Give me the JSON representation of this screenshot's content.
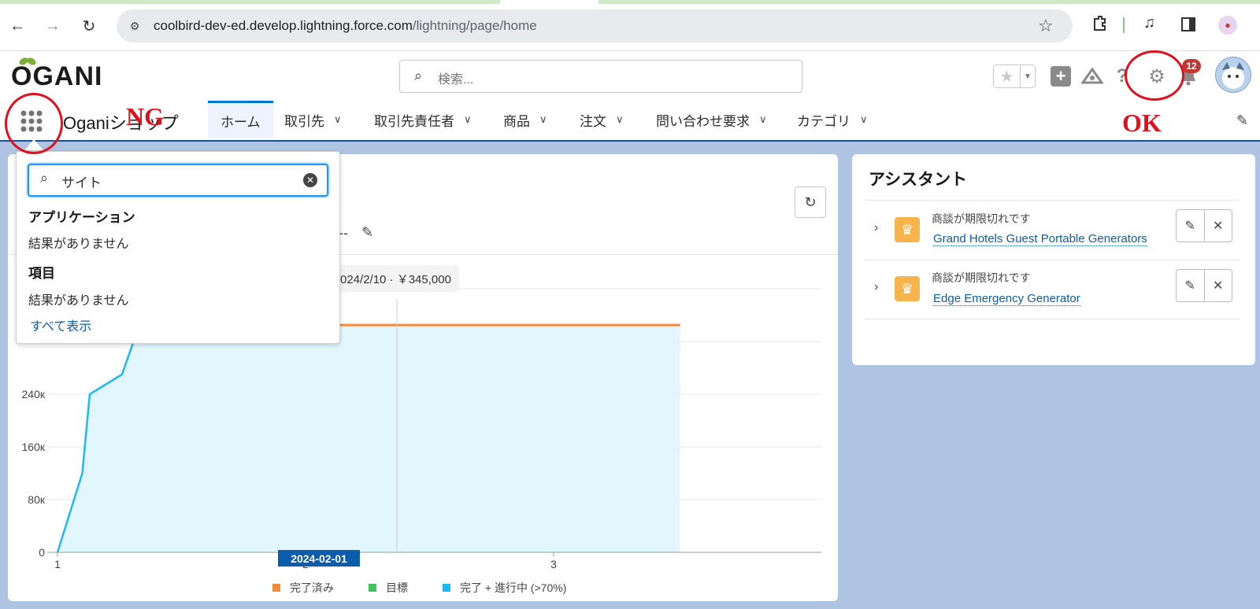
{
  "browser": {
    "url_domain": "coolbird-dev-ed.develop.lightning.force.com",
    "url_path": "/lightning/page/home"
  },
  "header": {
    "logo": "OGANI",
    "search_placeholder": "検索...",
    "notification_count": "12"
  },
  "nav": {
    "app_name": "Oganiショップ",
    "tabs": [
      {
        "label": "ホーム"
      },
      {
        "label": "取引先"
      },
      {
        "label": "取引先責任者"
      },
      {
        "label": "商品"
      },
      {
        "label": "注文"
      },
      {
        "label": "問い合わせ要求"
      },
      {
        "label": "カテゴリ"
      }
    ]
  },
  "app_launcher": {
    "search_value": "サイト",
    "apps_heading": "アプリケーション",
    "apps_empty": "結果がありません",
    "items_heading": "項目",
    "items_empty": "結果がありません",
    "show_all": "すべて表示"
  },
  "main_card": {
    "partial_title": "--",
    "tooltip": "024/2/10 · ￥345,000",
    "x_highlight": "2024-02-01"
  },
  "chart_data": {
    "type": "area",
    "y_ticks": [
      "0",
      "80к",
      "160к",
      "240к"
    ],
    "x_ticks": [
      "1",
      "2",
      "3"
    ],
    "legend": [
      "完了済み",
      "目標",
      "完了 + 進行中 (>70%)"
    ],
    "colors": {
      "completed": "#f38b3c",
      "target": "#3ec35d",
      "in_progress": "#1fb8f2"
    },
    "target_value": 345000,
    "series": [
      {
        "name": "完了 + 進行中 (>70%)",
        "points": [
          [
            1,
            0
          ],
          [
            1.1,
            120000
          ],
          [
            1.13,
            240000
          ],
          [
            1.26,
            270000
          ],
          [
            1.33,
            345000
          ],
          [
            3.51,
            345000
          ]
        ]
      }
    ]
  },
  "assistant": {
    "title": "アシスタント",
    "items": [
      {
        "subtitle": "商談が期限切れです",
        "link": "Grand Hotels Guest Portable Generators"
      },
      {
        "subtitle": "商談が期限切れです",
        "link": "Edge Emergency Generator"
      }
    ]
  },
  "annotations": {
    "ng": "NG",
    "ok": "OK"
  }
}
